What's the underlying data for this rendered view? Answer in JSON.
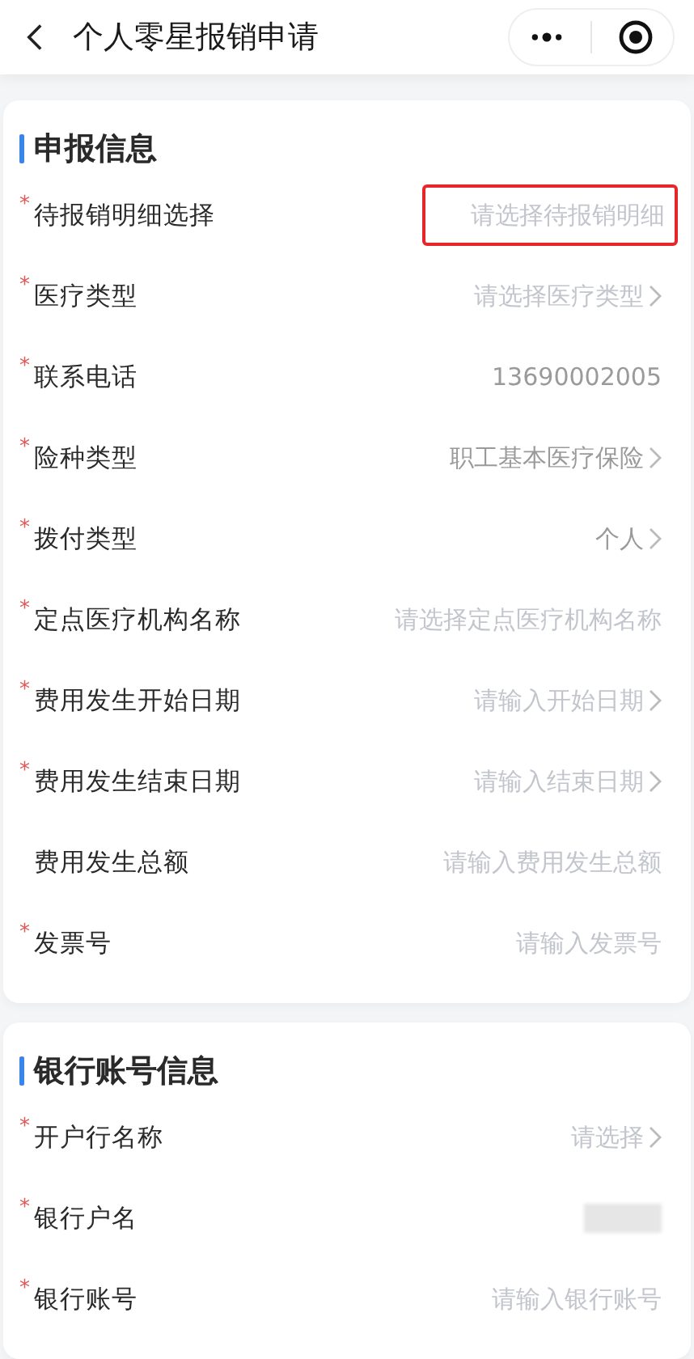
{
  "header": {
    "title": "个人零星报销申请"
  },
  "sections": [
    {
      "title": "申报信息",
      "fields": [
        {
          "label": "待报销明细选择",
          "required_mark": "*",
          "kind": "input",
          "placeholder": "请选择待报销明细",
          "chevron": false,
          "highlighted": true
        },
        {
          "label": "医疗类型",
          "required_mark": "*",
          "kind": "input",
          "placeholder": "请选择医疗类型",
          "chevron": true,
          "highlighted": false
        },
        {
          "label": "联系电话",
          "required_mark": "*",
          "kind": "value",
          "value": "13690002005",
          "chevron": false,
          "highlighted": false
        },
        {
          "label": "险种类型",
          "required_mark": "*",
          "kind": "value",
          "value": "职工基本医疗保险",
          "chevron": true,
          "highlighted": false
        },
        {
          "label": "拨付类型",
          "required_mark": "*",
          "kind": "value",
          "value": "个人",
          "chevron": true,
          "highlighted": false
        },
        {
          "label": "定点医疗机构名称",
          "required_mark": "*",
          "kind": "input",
          "placeholder": "请选择定点医疗机构名称",
          "chevron": false,
          "highlighted": false
        },
        {
          "label": "费用发生开始日期",
          "required_mark": "*",
          "kind": "input",
          "placeholder": "请输入开始日期",
          "chevron": true,
          "highlighted": false
        },
        {
          "label": "费用发生结束日期",
          "required_mark": "*",
          "kind": "input",
          "placeholder": "请输入结束日期",
          "chevron": true,
          "highlighted": false
        },
        {
          "label": "费用发生总额",
          "kind": "input",
          "placeholder": "请输入费用发生总额",
          "chevron": false,
          "highlighted": false
        },
        {
          "label": "发票号",
          "required_mark": "*",
          "kind": "input",
          "placeholder": "请输入发票号",
          "chevron": false,
          "highlighted": false
        }
      ]
    },
    {
      "title": "银行账号信息",
      "fields": [
        {
          "label": "开户行名称",
          "required_mark": "*",
          "kind": "input",
          "placeholder": "请选择",
          "chevron": true,
          "highlighted": false
        },
        {
          "label": "银行户名",
          "required_mark": "*",
          "kind": "redacted",
          "chevron": false,
          "highlighted": false
        },
        {
          "label": "银行账号",
          "required_mark": "*",
          "kind": "input",
          "placeholder": "请输入银行账号",
          "chevron": false,
          "highlighted": false
        }
      ]
    }
  ]
}
